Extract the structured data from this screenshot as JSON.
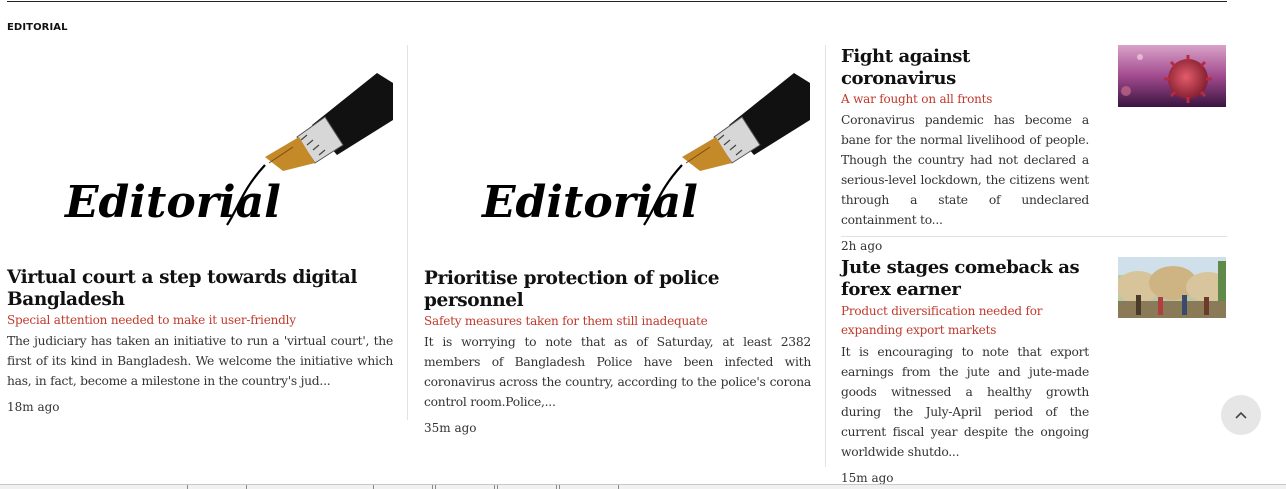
{
  "section": {
    "label": "EDITORIAL"
  },
  "articles": [
    {
      "title": "Virtual court a step towards digital Bangladesh",
      "subtitle": "Special attention needed to make it user-friendly",
      "excerpt": "The judiciary has taken an initiative to run a 'virtual court', the first of its kind in Bangladesh. We welcome the initiative which has, in fact, become a milestone in the country's jud...",
      "time": "18m ago",
      "image_text": "Editorial"
    },
    {
      "title": "Prioritise protection of police personnel",
      "subtitle": "Safety measures taken for them still inadequate",
      "excerpt": "It is worrying to note that as of Saturday, at least 2382 members of Bangladesh Police have been infected with coronavirus across the country, according to the police's corona control room.Police,...",
      "time": "35m ago",
      "image_text": "Editorial"
    },
    {
      "title": "Fight against coronavirus",
      "subtitle": "A war fought on all fronts",
      "excerpt": "Coronavirus pandemic has become a bane for the normal livelihood of people. Though the country had not declared a serious-level lockdown, the citizens went through a state of undeclared containment to...",
      "time": "2h ago"
    },
    {
      "title": "Jute stages comeback as forex earner",
      "subtitle": "Product diversification needed for expanding export markets",
      "excerpt": "It is encouraging to note that export earnings from the jute and jute-made goods witnessed a healthy growth during the July-April period of the current fiscal year despite the ongoing worldwide shutdo...",
      "time": "15m ago"
    }
  ],
  "colors": {
    "accent": "#c0392b",
    "divider": "#e2e2e2",
    "text": "#111111"
  },
  "icons": {
    "scroll_top": "chevron-up-icon"
  }
}
